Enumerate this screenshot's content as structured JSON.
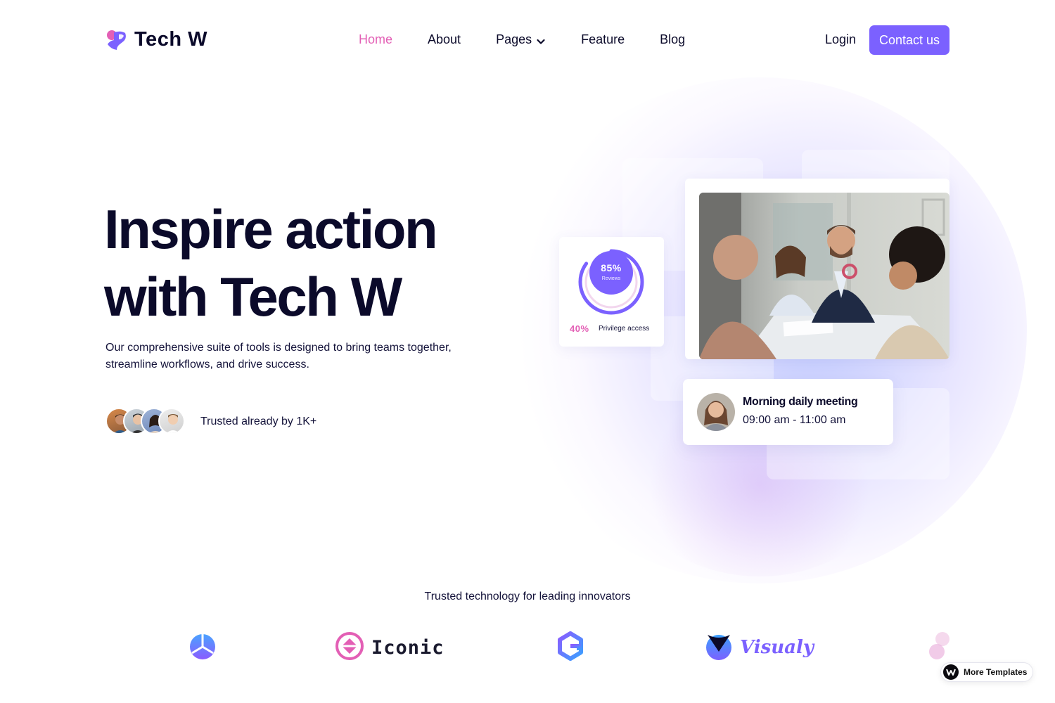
{
  "brand": {
    "name": "Tech W"
  },
  "nav": {
    "items": [
      {
        "label": "Home",
        "active": true
      },
      {
        "label": "About"
      },
      {
        "label": "Pages",
        "has_dropdown": true
      },
      {
        "label": "Feature"
      },
      {
        "label": "Blog"
      }
    ],
    "login": "Login",
    "contact": "Contact us"
  },
  "hero": {
    "title_line1": "Inspire action",
    "title_line2": "with Tech W",
    "subtitle": "Our comprehensive suite of tools is designed to bring teams together, streamline workflows, and drive success.",
    "trusted": "Trusted already by 1K+"
  },
  "stat_card": {
    "ring_value": "85%",
    "ring_label": "Reviews",
    "ring_fraction": 0.85,
    "secondary_value": "40%",
    "secondary_label": "Privilege access"
  },
  "meeting_card": {
    "title": "Morning daily meeting",
    "time": "09:00 am - 11:00 am"
  },
  "partners": {
    "heading": "Trusted technology for leading innovators",
    "logos": [
      {
        "icon": "pie-logo-icon"
      },
      {
        "icon": "iconic-logo-icon",
        "text": "Iconic"
      },
      {
        "icon": "hex-g-logo-icon"
      },
      {
        "icon": "visualy-logo-icon",
        "text": "Visualy"
      },
      {
        "icon": "circles-logo-icon"
      }
    ]
  },
  "badge": {
    "label": "More Templates"
  },
  "colors": {
    "accent": "#7b61ff",
    "pink": "#e35fb5",
    "ink": "#0b0a2a"
  }
}
